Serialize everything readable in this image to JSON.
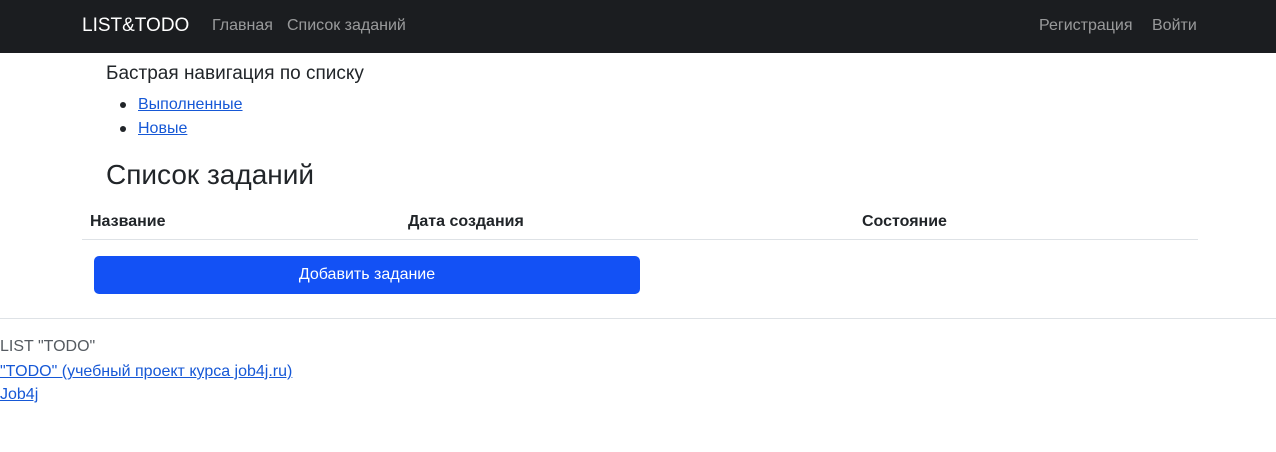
{
  "navbar": {
    "brand": "LIST&TODO",
    "links": {
      "home": "Главная",
      "tasks": "Список заданий",
      "register": "Регистрация",
      "login": "Войти"
    }
  },
  "quick_nav": {
    "title": "Бастрая навигация по списку",
    "items": [
      "Выполненные",
      "Новые"
    ]
  },
  "main": {
    "title": "Список заданий",
    "table": {
      "headers": [
        "Название",
        "Дата создания",
        "Состояние"
      ],
      "rows": []
    },
    "add_button_label": "Добавить задание"
  },
  "footer": {
    "text": "LIST \"TODO\"",
    "links": [
      "\"TODO\" (учебный проект курса job4j.ru)",
      "Job4j"
    ]
  },
  "colors": {
    "navbar_bg": "#1b1d20",
    "primary": "#1351f5",
    "link": "#1658d6"
  }
}
